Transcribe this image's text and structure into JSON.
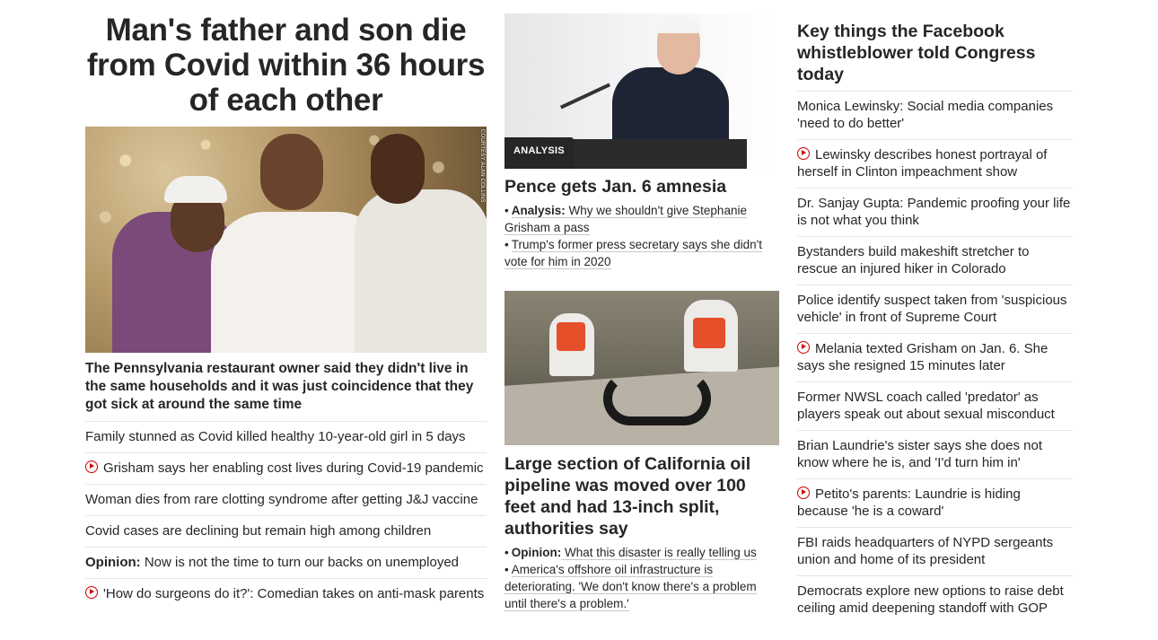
{
  "left": {
    "headline": "Man's father and son die from Covid within 36 hours of each other",
    "photo_credit": "COURTESY ALAN COLLINS",
    "description": "The Pennsylvania restaurant owner said they didn't live in the same households and it was just coincidence that they got sick at around the same time",
    "links": [
      {
        "text": "Family stunned as Covid killed healthy 10-year-old girl in 5 days",
        "video": false
      },
      {
        "text": "Grisham says her enabling cost lives during Covid-19 pandemic",
        "video": true
      },
      {
        "text": "Woman dies from rare clotting syndrome after getting J&J vaccine",
        "video": false
      },
      {
        "text": "Covid cases are declining but remain high among children",
        "video": false
      },
      {
        "prefix": "Opinion:",
        "text": " Now is not the time to turn our backs on unemployed",
        "video": false
      },
      {
        "text": "'How do surgeons do it?': Comedian takes on anti-mask parents",
        "video": true
      }
    ]
  },
  "mid": {
    "pence": {
      "tag": "ANALYSIS",
      "headline": "Pence gets Jan. 6 amnesia",
      "links": [
        {
          "prefix": "Analysis:",
          "text": " Why we shouldn't give Stephanie Grisham a pass"
        },
        {
          "text": "Trump's former press secretary says she didn't vote for him in 2020"
        }
      ]
    },
    "oil": {
      "headline": "Large section of California oil pipeline was moved over 100 feet and had 13-inch split, authorities say",
      "links": [
        {
          "prefix": "Opinion:",
          "text": " What this disaster is really telling us"
        },
        {
          "text": "America's offshore oil infrastructure is deteriorating. 'We don't know there's a problem until there's a problem.'"
        }
      ]
    }
  },
  "right": {
    "headline": "Key things the Facebook whistleblower told Congress today",
    "links": [
      {
        "text": "Monica Lewinsky: Social media companies 'need to do better'",
        "video": false
      },
      {
        "text": "Lewinsky describes honest portrayal of herself in Clinton impeachment show",
        "video": true
      },
      {
        "text": "Dr. Sanjay Gupta: Pandemic proofing your life is not what you think",
        "video": false
      },
      {
        "text": "Bystanders build makeshift stretcher to rescue an injured hiker in Colorado",
        "video": false
      },
      {
        "text": "Police identify suspect taken from 'suspicious vehicle' in front of Supreme Court",
        "video": false
      },
      {
        "text": "Melania texted Grisham on Jan. 6. She says she resigned 15 minutes later",
        "video": true
      },
      {
        "text": "Former NWSL coach called 'predator' as players speak out about sexual misconduct",
        "video": false
      },
      {
        "text": "Brian Laundrie's sister says she does not know where he is, and 'I'd turn him in'",
        "video": false
      },
      {
        "text": "Petito's parents: Laundrie is hiding because 'he is a coward'",
        "video": true
      },
      {
        "text": "FBI raids headquarters of NYPD sergeants union and home of its president",
        "video": false
      },
      {
        "text": "Democrats explore new options to raise debt ceiling amid deepening standoff with GOP",
        "video": false
      }
    ]
  },
  "colors": {
    "accent_red": "#cc0000",
    "text": "#262626",
    "divider": "#e6e6e6",
    "tag_bg": "#262626"
  },
  "icons": {
    "video": "play-circle-icon"
  }
}
